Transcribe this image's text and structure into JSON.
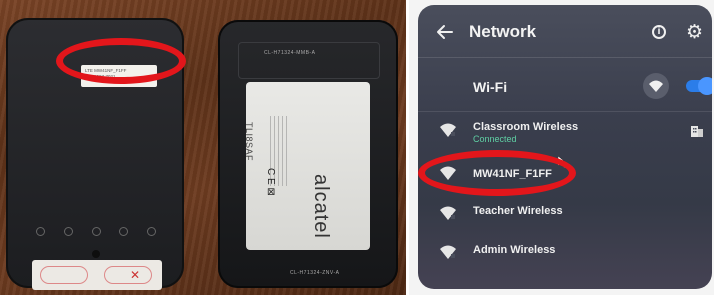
{
  "photo": {
    "cover_label_line1": "LTE MW41NF_F1FF",
    "cover_label_line2": "Pin: 1997-7021",
    "device_model_top": "CL-H71324-MMB-A",
    "device_model_bottom": "CL-H71324-ZNV-A",
    "battery_model": "TLI8SAF",
    "battery_brand": "alcatel",
    "battery_marks": "C E ⊠",
    "circle_color": "#e3161b"
  },
  "network_screen": {
    "title": "Network",
    "wifi_section_label": "Wi-Fi",
    "wifi_toggle_on": true,
    "accent_color": "#2b7de9",
    "networks": [
      {
        "name": "Classroom Wireless",
        "status": "Connected",
        "icon": "wifi-icon",
        "extra_icon": "enterprise-icon"
      },
      {
        "name": "MW41NF_F1FF",
        "status": "",
        "icon": "wifi-icon"
      },
      {
        "name": "Teacher Wireless",
        "status": "",
        "icon": "wifi-icon"
      },
      {
        "name": "Admin Wireless",
        "status": "",
        "icon": "wifi-icon"
      }
    ]
  }
}
